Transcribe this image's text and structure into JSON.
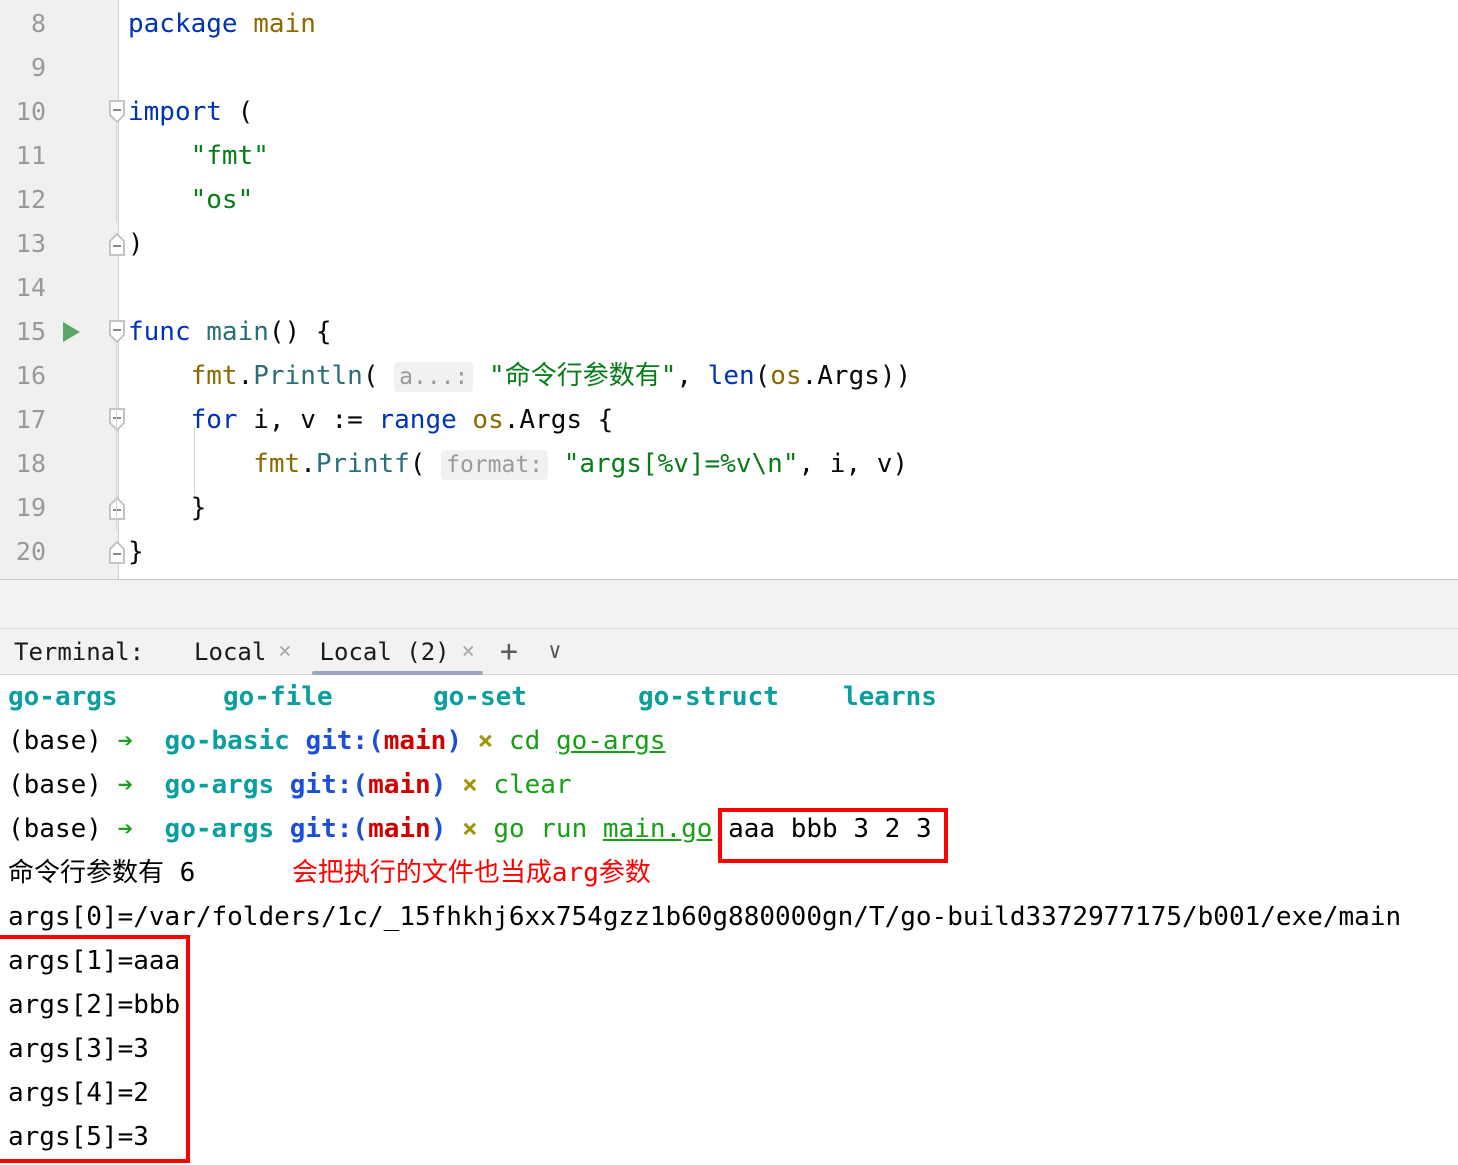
{
  "editor": {
    "lines": [
      {
        "no": "8",
        "indent": 0,
        "tokens": [
          {
            "t": "package ",
            "c": "kw"
          },
          {
            "t": "main",
            "c": "pkg"
          }
        ]
      },
      {
        "no": "9",
        "indent": 0,
        "tokens": []
      },
      {
        "no": "10",
        "indent": 0,
        "fold": "open",
        "tokens": [
          {
            "t": "import",
            "c": "kw"
          },
          {
            "t": " (",
            "c": "plain"
          }
        ]
      },
      {
        "no": "11",
        "indent": 0,
        "tokens": [
          {
            "t": "    ",
            "c": "plain"
          },
          {
            "t": "\"fmt\"",
            "c": "str"
          }
        ]
      },
      {
        "no": "12",
        "indent": 0,
        "tokens": [
          {
            "t": "    ",
            "c": "plain"
          },
          {
            "t": "\"os\"",
            "c": "str"
          }
        ]
      },
      {
        "no": "13",
        "indent": 0,
        "fold": "close",
        "tokens": [
          {
            "t": ")",
            "c": "plain"
          }
        ]
      },
      {
        "no": "14",
        "indent": 0,
        "tokens": []
      },
      {
        "no": "15",
        "indent": 0,
        "fold": "open",
        "run": true,
        "tokens": [
          {
            "t": "func",
            "c": "kw"
          },
          {
            "t": " ",
            "c": "plain"
          },
          {
            "t": "main",
            "c": "fn"
          },
          {
            "t": "() {",
            "c": "plain"
          }
        ]
      },
      {
        "no": "16",
        "indent": 0,
        "tokens": [
          {
            "t": "    ",
            "c": "plain"
          },
          {
            "t": "fmt",
            "c": "pkg"
          },
          {
            "t": ".",
            "c": "plain"
          },
          {
            "t": "Println",
            "c": "fn"
          },
          {
            "t": "( ",
            "c": "plain"
          },
          {
            "t": "a...:",
            "c": "hint"
          },
          {
            "t": " ",
            "c": "plain"
          },
          {
            "t": "\"命令行参数有\"",
            "c": "str"
          },
          {
            "t": ", ",
            "c": "plain"
          },
          {
            "t": "len",
            "c": "kw"
          },
          {
            "t": "(",
            "c": "plain"
          },
          {
            "t": "os",
            "c": "pkg"
          },
          {
            "t": ".Args))",
            "c": "plain"
          }
        ]
      },
      {
        "no": "17",
        "indent": 0,
        "fold": "open",
        "tokens": [
          {
            "t": "    ",
            "c": "plain"
          },
          {
            "t": "for",
            "c": "kw"
          },
          {
            "t": " i, v := ",
            "c": "plain"
          },
          {
            "t": "range",
            "c": "kw"
          },
          {
            "t": " ",
            "c": "plain"
          },
          {
            "t": "os",
            "c": "pkg"
          },
          {
            "t": ".Args {",
            "c": "plain"
          }
        ]
      },
      {
        "no": "18",
        "indent": 0,
        "tokens": [
          {
            "t": "        ",
            "c": "plain"
          },
          {
            "t": "fmt",
            "c": "pkg"
          },
          {
            "t": ".",
            "c": "plain"
          },
          {
            "t": "Printf",
            "c": "fn"
          },
          {
            "t": "( ",
            "c": "plain"
          },
          {
            "t": "format:",
            "c": "hint"
          },
          {
            "t": " ",
            "c": "plain"
          },
          {
            "t": "\"args[%v]=%v\\n\"",
            "c": "str"
          },
          {
            "t": ", i, v)",
            "c": "plain"
          }
        ]
      },
      {
        "no": "19",
        "indent": 0,
        "fold": "close",
        "tokens": [
          {
            "t": "    }",
            "c": "plain"
          }
        ]
      },
      {
        "no": "20",
        "indent": 0,
        "fold": "close",
        "tokens": [
          {
            "t": "}",
            "c": "plain"
          }
        ]
      }
    ]
  },
  "terminal": {
    "label": "Terminal:",
    "tabs": [
      {
        "title": "Local",
        "active": false,
        "close": "×"
      },
      {
        "title": "Local (2)",
        "active": true,
        "close": "×"
      }
    ],
    "add_icon": "+",
    "chevron_icon": "∨",
    "dir_listing": [
      "go-args",
      "go-file",
      "go-set",
      "go-struct",
      "learns"
    ],
    "prompt": {
      "env": "(base)",
      "arrow": "➔",
      "git_prefix": "git:",
      "git_open": "(",
      "git_branch": "main",
      "git_close": ")",
      "dirty": "×"
    },
    "commands": [
      {
        "cwd": "go-basic",
        "cmd": "cd",
        "arg": "go-args",
        "arg_underline": true
      },
      {
        "cwd": "go-args",
        "cmd": "clear",
        "arg": "",
        "arg_underline": false
      },
      {
        "cwd": "go-args",
        "cmd": "go run",
        "arg": "main.go",
        "arg_underline": true,
        "extra": "aaa bbb 3 2 3",
        "extra_boxed": true
      }
    ],
    "output": {
      "count_line": "命令行参数有 6",
      "count_note": "会把执行的文件也当成arg参数",
      "args": [
        "args[0]=/var/folders/1c/_15fhkhj6xx754gzz1b60g880000gn/T/go-build3372977175/b001/exe/main",
        "args[1]=aaa",
        "args[2]=bbb",
        "args[3]=3",
        "args[4]=2",
        "args[5]=3"
      ]
    }
  },
  "colors": {
    "annotation_red": "#ff0000",
    "keyword_blue": "#0033b3",
    "string_green": "#067d17",
    "package_olive": "#8c6a00",
    "function_teal": "#2a6f77",
    "terminal_teal": "#0a9e9e",
    "active_tab_underline": "#9aa7bd"
  }
}
